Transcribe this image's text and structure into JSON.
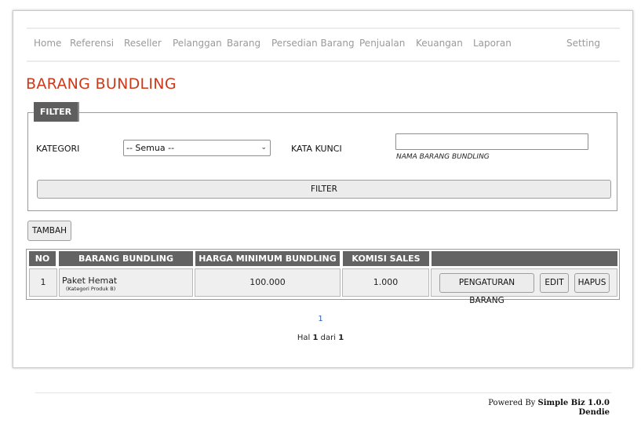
{
  "nav": {
    "items": [
      "Home",
      "Referensi",
      "Reseller",
      "Pelanggan",
      "Barang",
      "Persedian Barang",
      "Penjualan",
      "Keuangan",
      "Laporan"
    ],
    "setting": "Setting"
  },
  "page_title": "BARANG BUNDLING",
  "filter": {
    "legend": "FILTER",
    "kategori_label": "KATEGORI",
    "kategori_value": "-- Semua --",
    "kata_kunci_label": "KATA KUNCI",
    "kata_kunci_value": "",
    "kata_kunci_hint": "NAMA BARANG BUNDLING",
    "button": "FILTER"
  },
  "tambah_button": "TAMBAH",
  "table": {
    "headers": [
      "NO",
      "BARANG BUNDLING",
      "HARGA MINIMUM BUNDLING",
      "KOMISI SALES",
      ""
    ],
    "rows": [
      {
        "no": "1",
        "name": "Paket Hemat",
        "category": "(Kategori Produk B)",
        "harga": "100.000",
        "komisi": "1.000",
        "actions": [
          "PENGATURAN BARANG",
          "EDIT",
          "HAPUS"
        ]
      }
    ]
  },
  "pagination": {
    "current_page_link": "1",
    "hal_prefix": "Hal",
    "page": "1",
    "dari": "dari",
    "total": "1"
  },
  "footer": {
    "powered_prefix": "Powered By",
    "product": "Simple Biz 1.0.0",
    "author": "Dendie"
  },
  "colors": {
    "title": "#cc3a1a",
    "header_bg": "#636363",
    "nav_text": "#9a9a9a"
  }
}
